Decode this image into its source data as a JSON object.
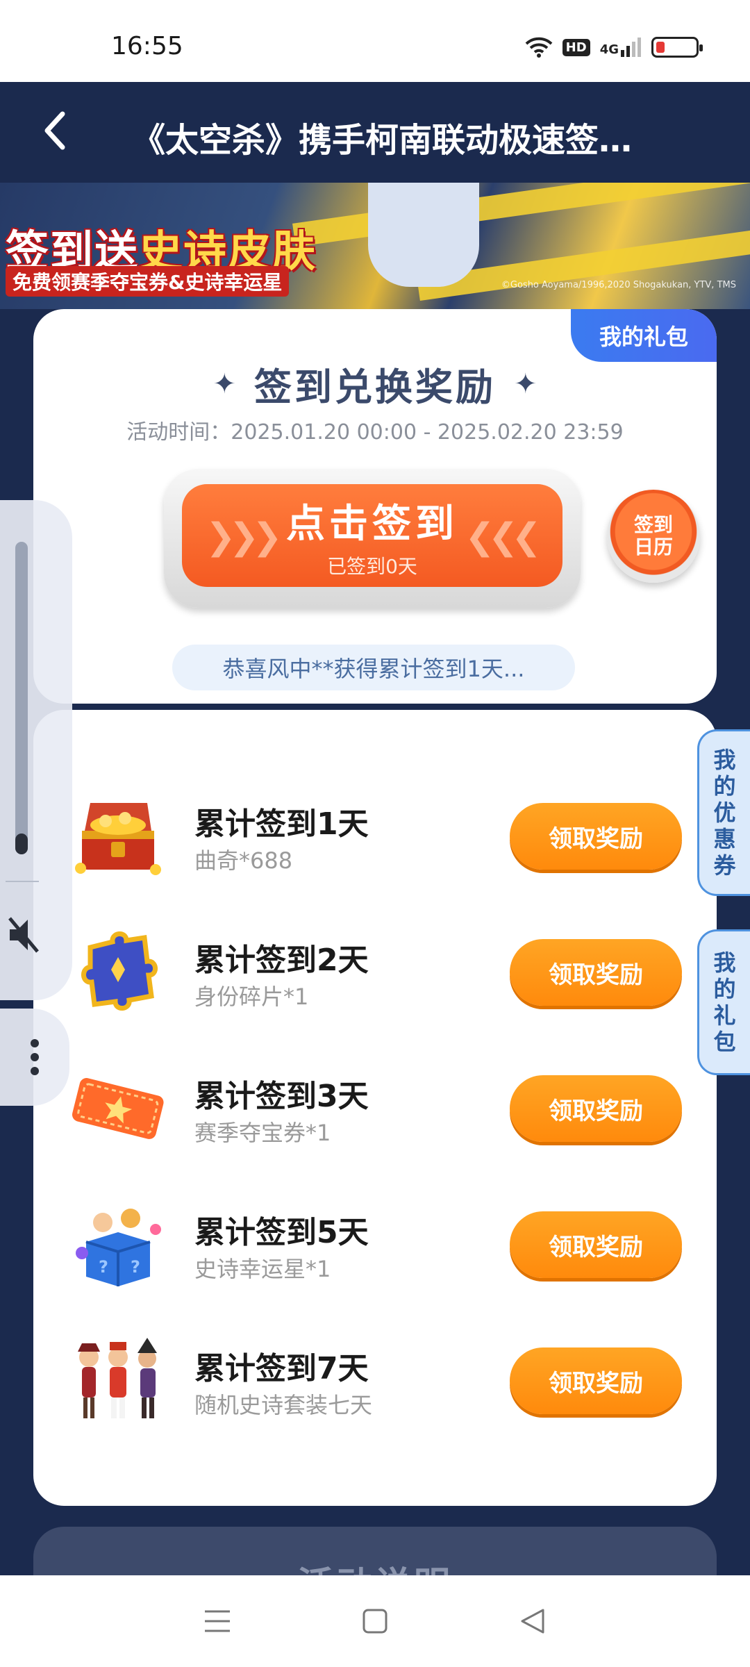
{
  "status_bar": {
    "time": "16:55",
    "hd_label": "HD",
    "network_label": "4G",
    "icons": [
      "wifi-icon",
      "hd-icon",
      "signal-4g-icon",
      "battery-low-icon"
    ],
    "battery_color": "#e53935"
  },
  "header": {
    "title": "《太空杀》携手柯南联动极速签…",
    "back_icon": "chevron-left-icon"
  },
  "banner": {
    "title_prefix": "签到送",
    "title_highlight": "史诗皮肤",
    "subtitle": "免费领赛季夺宝券&史诗幸运星",
    "copyright": "©Gosho Aoyama/1996,2020 Shogakukan, YTV, TMS"
  },
  "checkin_card": {
    "my_gift_tab": "我的礼包",
    "heading": "签到兑换奖励",
    "activity_time": "活动时间：2025.01.20 00:00 - 2025.02.20 23:59",
    "checkin_button_label": "点击签到",
    "checkin_status": "已签到0天",
    "calendar_label": "签到日历",
    "notice": "恭喜风中**获得累计签到1天..."
  },
  "rewards": [
    {
      "title": "累计签到1天",
      "desc": "曲奇*688",
      "button": "领取奖励",
      "icon": "treasure-chest-icon"
    },
    {
      "title": "累计签到2天",
      "desc": "身份碎片*1",
      "button": "领取奖励",
      "icon": "puzzle-piece-icon"
    },
    {
      "title": "累计签到3天",
      "desc": "赛季夺宝券*1",
      "button": "领取奖励",
      "icon": "ticket-icon"
    },
    {
      "title": "累计签到5天",
      "desc": "史诗幸运星*1",
      "button": "领取奖励",
      "icon": "mystery-box-icon"
    },
    {
      "title": "累计签到7天",
      "desc": "随机史诗套装七天",
      "button": "领取奖励",
      "icon": "character-costumes-icon"
    }
  ],
  "side_tabs": {
    "coupons": "我的优惠券",
    "gifts": "我的礼包"
  },
  "rules_card": {
    "heading": "活动说明"
  },
  "overlay": {
    "volume_level": 0.05,
    "icons": [
      "mute-icon",
      "more-vertical-icon"
    ]
  },
  "nav_bar": {
    "icons": [
      "menu-icon",
      "home-icon",
      "back-icon"
    ]
  },
  "colors": {
    "page_bg": "#1b2a4e",
    "accent_orange": "#ff8a0c",
    "checkin_orange": "#f45a22",
    "tab_blue": "#3b7bf0"
  }
}
